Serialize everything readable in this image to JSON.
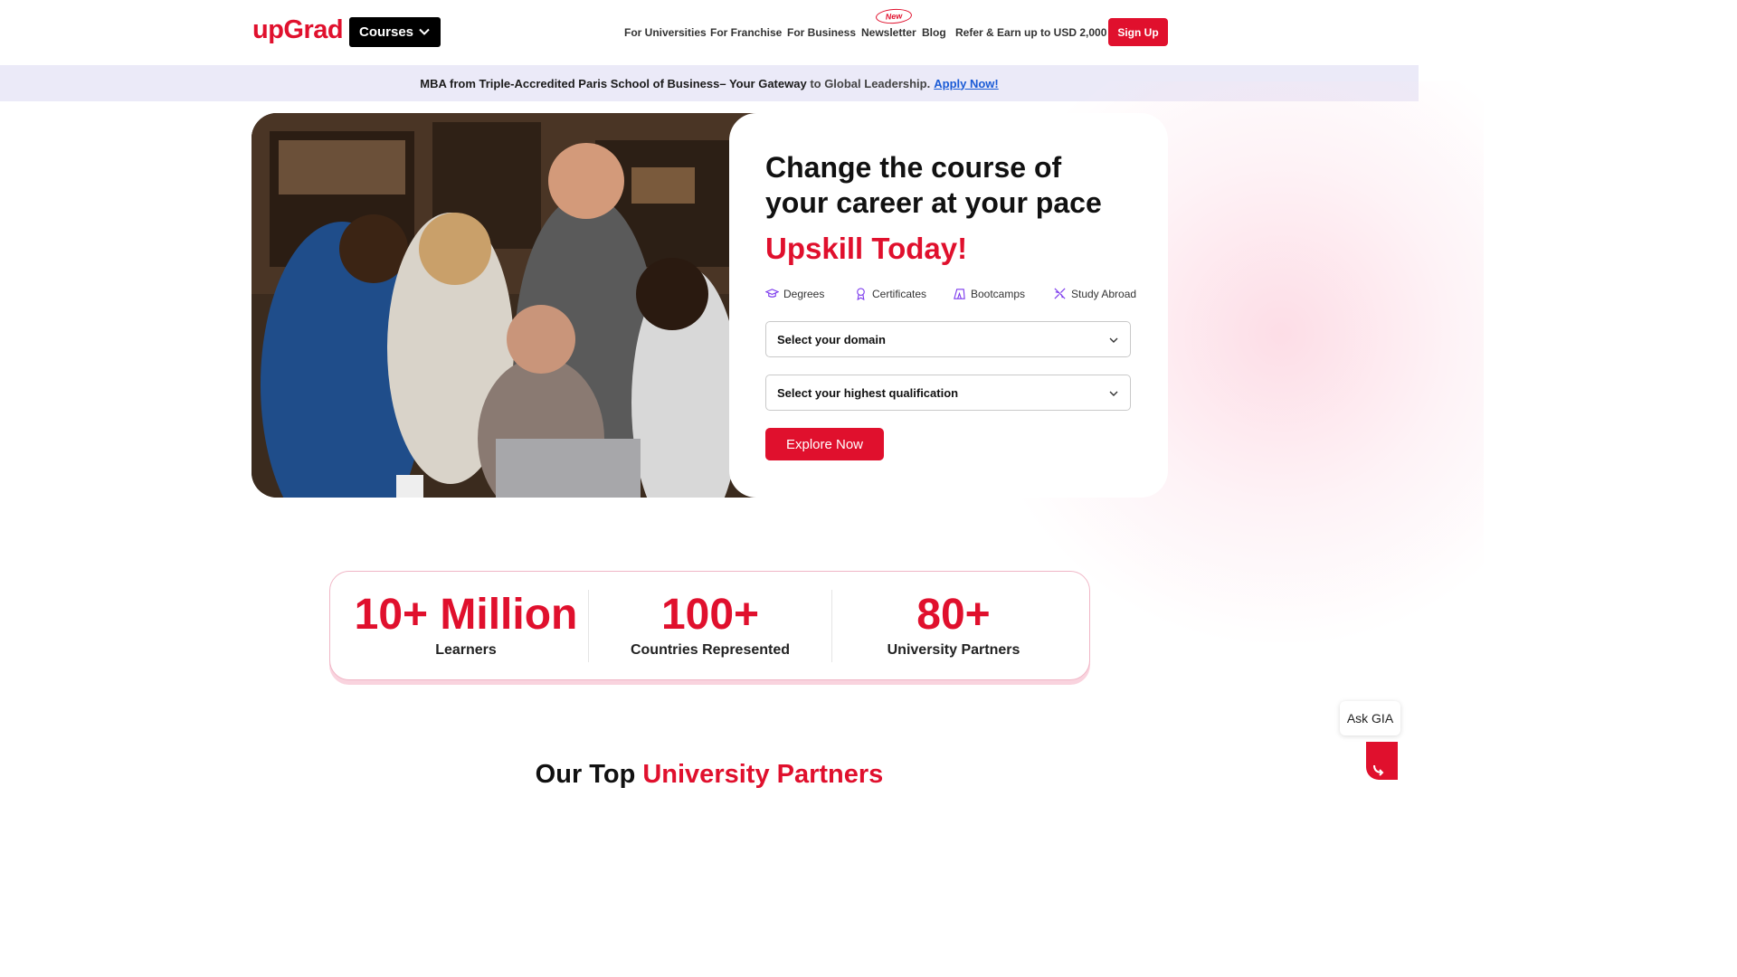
{
  "header": {
    "logo": "upGrad",
    "courses_label": "Courses",
    "nav": {
      "universities": "For Universities",
      "franchise": "For Franchise",
      "business": "For Business",
      "newsletter": "Newsletter",
      "newsletter_badge": "New",
      "blog": "Blog",
      "refer": "Refer & Earn up to USD 2,000"
    },
    "signup_label": "Sign Up"
  },
  "banner": {
    "text_main": "MBA from Triple-Accredited Paris School of Business– Your Gateway",
    "text_soft": "to Global Leadership.",
    "link": "Apply Now!"
  },
  "hero": {
    "title": "Change the course of your career at your pace",
    "accent": "Upskill Today!",
    "categories": [
      {
        "label": "Degrees",
        "icon": "graduation-cap-icon"
      },
      {
        "label": "Certificates",
        "icon": "award-ribbon-icon"
      },
      {
        "label": "Bootcamps",
        "icon": "bootcamp-icon"
      },
      {
        "label": "Study Abroad",
        "icon": "airplane-icon"
      }
    ],
    "domain_select": "Select your domain",
    "qualification_select": "Select your highest qualification",
    "cta": "Explore Now"
  },
  "stats": [
    {
      "value": "10+ Million",
      "label": "Learners"
    },
    {
      "value": "100+",
      "label": "Countries Represented"
    },
    {
      "value": "80+",
      "label": "University Partners"
    }
  ],
  "partners_section": {
    "title_plain": "Our Top",
    "title_accent": "University Partners"
  },
  "assistant": {
    "label": "Ask GIA"
  },
  "colors": {
    "brand": "#e0102d",
    "banner_bg": "#ebeaf8",
    "link": "#1a5bd6"
  }
}
